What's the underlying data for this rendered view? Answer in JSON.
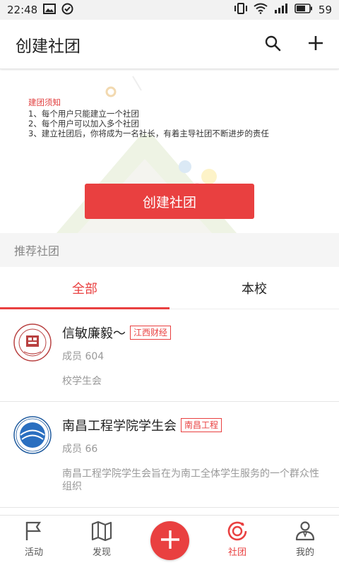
{
  "status_bar": {
    "time": "22:48",
    "battery": "59"
  },
  "app_bar": {
    "title": "创建社团"
  },
  "notice": {
    "heading": "建团须知",
    "lines": [
      "1、每个用户只能建立一个社团",
      "2、每个用户可以加入多个社团",
      "3、建立社团后，你将成为一名社长，有着主导社团不断进步的责任"
    ]
  },
  "create_button": "创建社团",
  "section_title": "推荐社团",
  "tabs": [
    {
      "label": "全部",
      "active": true
    },
    {
      "label": "本校",
      "active": false
    }
  ],
  "clubs": [
    {
      "name": "信敏廉毅～",
      "school_tag": "江西财经",
      "members": "成员 604",
      "description": "校学生会"
    },
    {
      "name": "南昌工程学院学生会",
      "school_tag": "南昌工程",
      "members": "成员 66",
      "description": "南昌工程学院学生会旨在为南工全体学生服务的一个群众性组织"
    }
  ],
  "bottom_nav": [
    {
      "label": "活动",
      "icon": "flag-icon",
      "active": false
    },
    {
      "label": "发现",
      "icon": "map-icon",
      "active": false
    },
    {
      "label": "社团",
      "icon": "club-icon",
      "active": true
    },
    {
      "label": "我的",
      "icon": "person-icon",
      "active": false
    }
  ],
  "colors": {
    "accent": "#e94040",
    "section_bg": "#f5f5f5",
    "muted_text": "#999999"
  }
}
